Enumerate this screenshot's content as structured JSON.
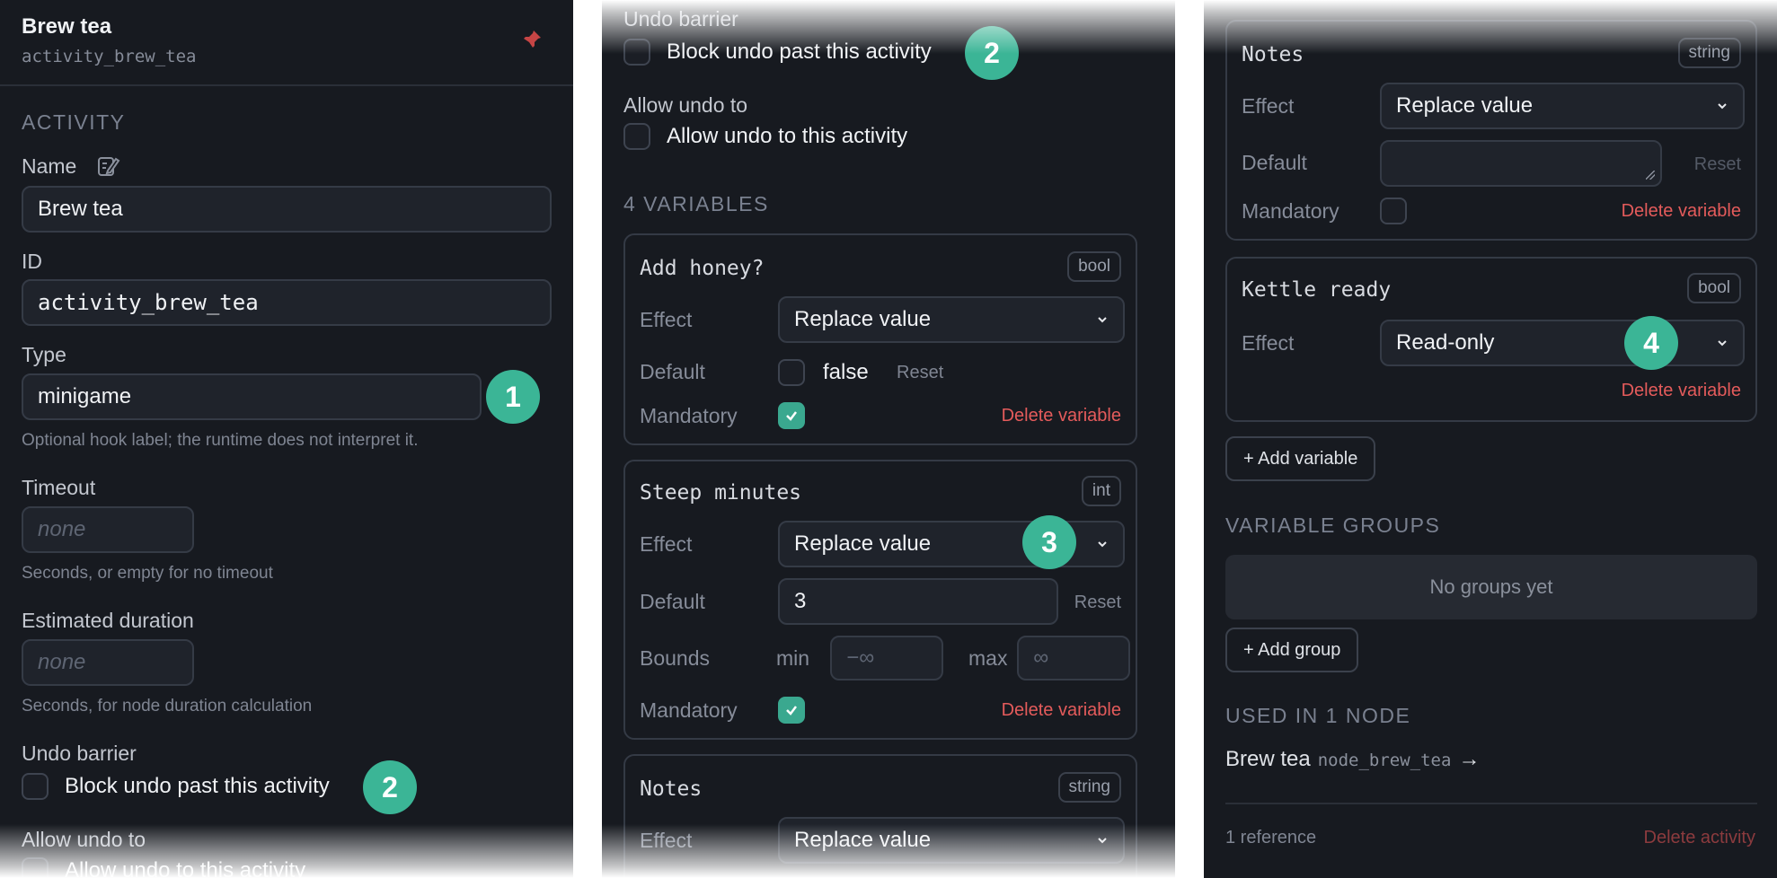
{
  "panel1": {
    "header": {
      "title": "Brew tea",
      "id": "activity_brew_tea"
    },
    "section_title": "ACTIVITY",
    "name": {
      "label": "Name",
      "value": "Brew tea"
    },
    "id_field": {
      "label": "ID",
      "value": "activity_brew_tea"
    },
    "type": {
      "label": "Type",
      "value": "minigame",
      "hint": "Optional hook label; the runtime does not interpret it."
    },
    "timeout": {
      "label": "Timeout",
      "placeholder": "none",
      "hint": "Seconds, or empty for no timeout"
    },
    "estimated": {
      "label": "Estimated duration",
      "placeholder": "none",
      "hint": "Seconds, for node duration calculation"
    },
    "undo_barrier": {
      "label": "Undo barrier",
      "checkbox_label": "Block undo past this activity"
    },
    "allow_undo": {
      "label": "Allow undo to",
      "checkbox_label": "Allow undo to this activity"
    },
    "markers": {
      "type": "1",
      "undo": "2"
    }
  },
  "panel2": {
    "undo_barrier": {
      "label": "Undo barrier",
      "checkbox_label": "Block undo past this activity"
    },
    "allow_undo": {
      "label": "Allow undo to",
      "checkbox_label": "Allow undo to this activity"
    },
    "variables_title": "4 VARIABLES",
    "var1": {
      "name": "Add honey?",
      "type": "bool",
      "effect_label": "Effect",
      "effect": "Replace value",
      "default_label": "Default",
      "default_value": "false",
      "reset": "Reset",
      "mandatory_label": "Mandatory",
      "mandatory": true,
      "delete": "Delete variable"
    },
    "var2": {
      "name": "Steep minutes",
      "type": "int",
      "effect_label": "Effect",
      "effect": "Replace value",
      "default_label": "Default",
      "default_value": "3",
      "reset": "Reset",
      "bounds_label": "Bounds",
      "min_label": "min",
      "min_placeholder": "−∞",
      "max_label": "max",
      "max_placeholder": "∞",
      "mandatory_label": "Mandatory",
      "mandatory": true,
      "delete": "Delete variable"
    },
    "var3": {
      "name": "Notes",
      "type": "string",
      "effect_label": "Effect",
      "effect": "Replace value"
    },
    "markers": {
      "undo": "2",
      "effect": "3"
    }
  },
  "panel3": {
    "var3": {
      "name": "Notes",
      "type": "string",
      "effect_label": "Effect",
      "effect": "Replace value",
      "default_label": "Default",
      "reset": "Reset",
      "mandatory_label": "Mandatory",
      "mandatory": false,
      "delete": "Delete variable"
    },
    "var4": {
      "name": "Kettle ready",
      "type": "bool",
      "effect_label": "Effect",
      "effect": "Read-only",
      "delete": "Delete variable"
    },
    "add_variable": "+ Add variable",
    "groups_title": "VARIABLE GROUPS",
    "no_groups": "No groups yet",
    "add_group": "+ Add group",
    "used_title": "USED IN 1 NODE",
    "used_node": {
      "name": "Brew tea",
      "id": "node_brew_tea",
      "arrow": "→"
    },
    "reference_count": "1 reference",
    "delete_activity": "Delete activity",
    "markers": {
      "readonly": "4"
    }
  },
  "colors": {
    "accent": "#3bb596",
    "danger": "#e45b5b",
    "panel": "#171a20"
  },
  "icons": {
    "pin": "pin-icon",
    "edit": "edit-icon",
    "chevron": "chevron-down-icon",
    "check": "check-icon",
    "arrow": "arrow-right-icon"
  }
}
